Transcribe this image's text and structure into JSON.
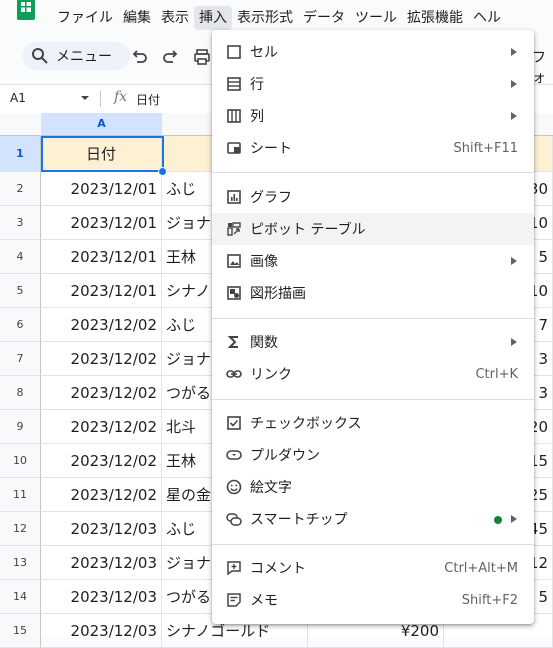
{
  "menubar": {
    "items": [
      "ファイル",
      "編集",
      "表示",
      "挿入",
      "表示形式",
      "データ",
      "ツール",
      "拡張機能",
      "ヘル"
    ],
    "active_index": 3
  },
  "toolbar": {
    "search_label": "メニュー",
    "right_fragment": "フォ"
  },
  "formula_bar": {
    "cell_ref": "A1",
    "fx": "fx",
    "content": "日付"
  },
  "grid": {
    "col_headers": [
      "A"
    ],
    "row_numbers": [
      "1",
      "2",
      "3",
      "4",
      "5",
      "6",
      "7",
      "8",
      "9",
      "10",
      "11",
      "12",
      "13",
      "14",
      "15"
    ],
    "header_cell": "日付",
    "dates": [
      "2023/12/01",
      "2023/12/01",
      "2023/12/01",
      "2023/12/01",
      "2023/12/02",
      "2023/12/02",
      "2023/12/02",
      "2023/12/02",
      "2023/12/02",
      "2023/12/02",
      "2023/12/03",
      "2023/12/03",
      "2023/12/03",
      "2023/12/03"
    ],
    "products": [
      "ふじ",
      "ジョナ",
      "王林",
      "シナノ",
      "ふじ",
      "ジョナ",
      "つがる",
      "北斗",
      "王林",
      "星の金",
      "ふじ",
      "ジョナ",
      "つがる",
      "シナノゴールド"
    ],
    "right_values": [
      "30",
      "10",
      "5",
      "10",
      "7",
      "3",
      "3",
      "20",
      "15",
      "25",
      "45",
      "12",
      "5",
      ""
    ],
    "last_price": "¥200"
  },
  "insert_menu": {
    "items": [
      {
        "label": "セル",
        "icon": "cell-icon",
        "submenu": true
      },
      {
        "label": "行",
        "icon": "row-icon",
        "submenu": true
      },
      {
        "label": "列",
        "icon": "column-icon",
        "submenu": true
      },
      {
        "label": "シート",
        "icon": "sheet-icon",
        "shortcut": "Shift+F11"
      },
      {
        "label": "グラフ",
        "icon": "chart-icon"
      },
      {
        "label": "ピボット テーブル",
        "icon": "pivot-table-icon",
        "hover": true
      },
      {
        "label": "画像",
        "icon": "image-icon",
        "submenu": true
      },
      {
        "label": "図形描画",
        "icon": "drawing-icon"
      },
      {
        "label": "関数",
        "icon": "sigma-icon",
        "submenu": true
      },
      {
        "label": "リンク",
        "icon": "link-icon",
        "shortcut": "Ctrl+K"
      },
      {
        "label": "チェックボックス",
        "icon": "checkbox-icon"
      },
      {
        "label": "プルダウン",
        "icon": "dropdown-icon"
      },
      {
        "label": "絵文字",
        "icon": "emoji-icon"
      },
      {
        "label": "スマートチップ",
        "icon": "smart-chip-icon",
        "submenu": true,
        "new_dot": true
      },
      {
        "label": "コメント",
        "icon": "comment-icon",
        "shortcut": "Ctrl+Alt+M"
      },
      {
        "label": "メモ",
        "icon": "note-icon",
        "shortcut": "Shift+F2"
      }
    ]
  },
  "colors": {
    "accent": "#1a73e8",
    "header_fill": "#fdf0d3",
    "hover": "#f1f3f4",
    "new_dot": "#188038"
  }
}
